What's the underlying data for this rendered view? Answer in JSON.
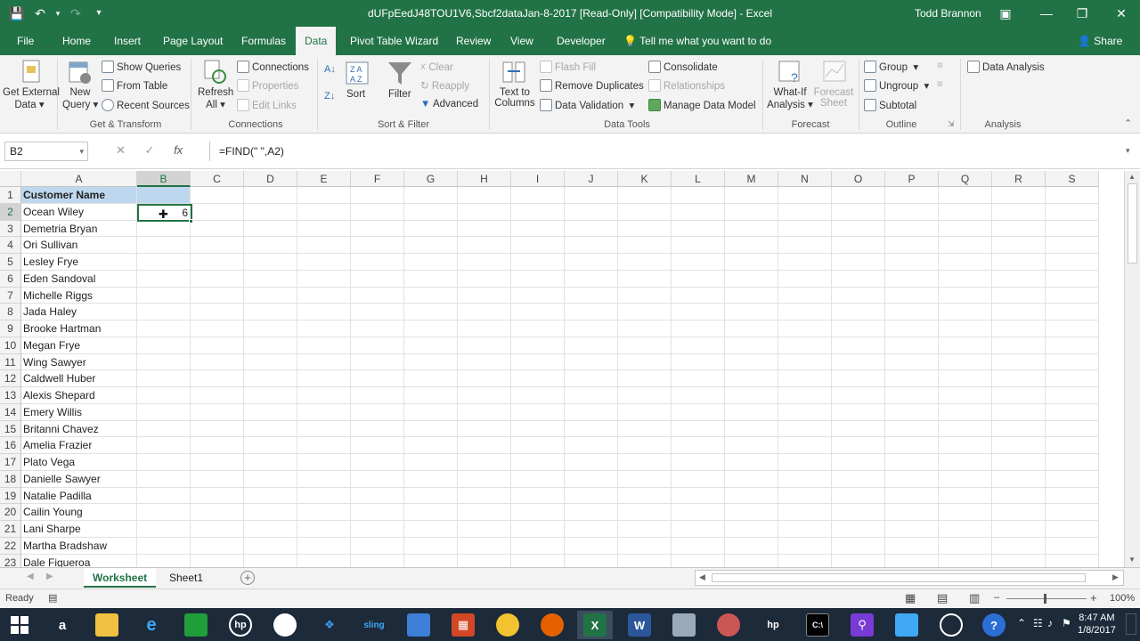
{
  "titlebar": {
    "title": "dUFpEedJ48TOU1V6,Sbcf2dataJan-8-2017  [Read-Only]  [Compatibility Mode] - Excel",
    "user": "Todd Brannon"
  },
  "tabs": [
    "File",
    "Home",
    "Insert",
    "Page Layout",
    "Formulas",
    "Data",
    "Pivot Table Wizard",
    "Review",
    "View",
    "Developer"
  ],
  "tell_me": "Tell me what you want to do",
  "share": "Share",
  "ribbon": {
    "get_external": [
      "Get External",
      "Data"
    ],
    "new_query": [
      "New",
      "Query"
    ],
    "show_queries": "Show Queries",
    "from_table": "From Table",
    "recent_sources": "Recent Sources",
    "refresh_all": [
      "Refresh",
      "All"
    ],
    "connections": "Connections",
    "properties": "Properties",
    "edit_links": "Edit Links",
    "sort": "Sort",
    "filter": "Filter",
    "clear": "Clear",
    "reapply": "Reapply",
    "advanced": "Advanced",
    "text_to_columns": [
      "Text to",
      "Columns"
    ],
    "flash_fill": "Flash Fill",
    "remove_duplicates": "Remove Duplicates",
    "data_validation": "Data Validation",
    "consolidate": "Consolidate",
    "relationships": "Relationships",
    "manage_data_model": "Manage Data Model",
    "what_if": [
      "What-If",
      "Analysis"
    ],
    "forecast_sheet": [
      "Forecast",
      "Sheet"
    ],
    "group": "Group",
    "ungroup": "Ungroup",
    "subtotal": "Subtotal",
    "data_analysis": "Data Analysis",
    "groups": [
      "Get & Transform",
      "Connections",
      "Sort & Filter",
      "Data Tools",
      "Forecast",
      "Outline",
      "Analysis"
    ]
  },
  "formula_bar": {
    "name_box": "B2",
    "fx": "fx",
    "formula": "=FIND(\" \",A2)"
  },
  "columns": [
    "A",
    "B",
    "C",
    "D",
    "E",
    "F",
    "G",
    "H",
    "I",
    "J",
    "K",
    "L",
    "M",
    "N",
    "O",
    "P",
    "Q",
    "R",
    "S"
  ],
  "rows": {
    "numbers": [
      "1",
      "2",
      "3",
      "4",
      "5",
      "6",
      "7",
      "8",
      "9",
      "10",
      "11",
      "12",
      "13",
      "14",
      "15",
      "16",
      "17",
      "18",
      "19",
      "20",
      "21",
      "22",
      "23"
    ],
    "col_a": [
      "Customer Name",
      "Ocean Wiley",
      "Demetria Bryan",
      "Ori Sullivan",
      "Lesley Frye",
      "Eden Sandoval",
      "Michelle Riggs",
      "Jada Haley",
      "Brooke Hartman",
      "Megan Frye",
      "Wing Sawyer",
      "Caldwell Huber",
      "Alexis Shepard",
      "Emery Willis",
      "Britanni Chavez",
      "Amelia Frazier",
      "Plato Vega",
      "Danielle Sawyer",
      "Natalie Padilla",
      "Cailin Young",
      "Lani Sharpe",
      "Martha Bradshaw",
      "Dale Figueroa"
    ],
    "b2_value": "6"
  },
  "sheets": [
    "Worksheet",
    "Sheet1"
  ],
  "status": {
    "ready": "Ready",
    "zoom": "100%"
  },
  "taskbar": {
    "time": "8:47 AM",
    "date": "1/8/2017"
  },
  "colors": {
    "excel_green": "#217346",
    "header_fill": "#bdd7ee"
  }
}
